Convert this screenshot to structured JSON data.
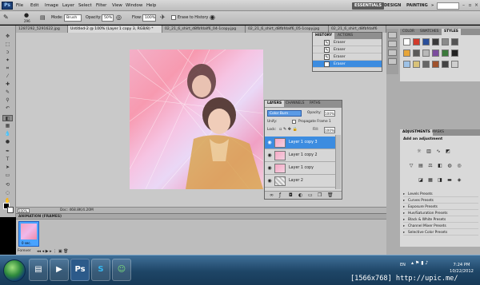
{
  "app": {
    "logo": "Ps"
  },
  "menu": [
    "File",
    "Edit",
    "Image",
    "Layer",
    "Select",
    "Filter",
    "View",
    "Window",
    "Help"
  ],
  "workspaces": {
    "essentials": "ESSENTIALS",
    "design": "DESIGN",
    "painting": "PAINTING",
    "more": "»"
  },
  "options": {
    "brush_size": "296",
    "mode_label": "Mode:",
    "mode_value": "Brush",
    "opacity_label": "Opacity:",
    "opacity_value": "50%",
    "flow_label": "Flow:",
    "flow_value": "100%",
    "erase_history": "Erase to History"
  },
  "tabs": [
    {
      "label": "1287292_5291622.jpg"
    },
    {
      "label": "Untitled-2 @ 100% (Layer 1 copy 3, RGB/8) *"
    },
    {
      "label": "02_21_6_shirt_d8fbfdalf6_04-1copy.jpg"
    },
    {
      "label": "02_21_6_shirt_d8fbfdalf6_05-1copy.jpg"
    },
    {
      "label": "02_21_6_shirt_d8fbfdalf6"
    }
  ],
  "status": {
    "zoom": "100%",
    "doc": "Doc: 468.8K/4.20M"
  },
  "history": {
    "tabs": [
      "HISTORY",
      "ACTIONS"
    ],
    "items": [
      {
        "label": "Eraser"
      },
      {
        "label": "Eraser"
      },
      {
        "label": "Eraser"
      },
      {
        "label": "Eraser"
      }
    ]
  },
  "layers": {
    "tabs": [
      "LAYERS",
      "CHANNELS",
      "PATHS"
    ],
    "blend_mode": "Color Burn",
    "opacity_label": "Opacity:",
    "opacity": "100%",
    "unify_label": "Unify:",
    "propagate_label": "Propagate Frame 1",
    "lock_label": "Lock:",
    "fill_label": "Fill:",
    "fill": "100%",
    "items": [
      {
        "name": "Layer 1 copy 3"
      },
      {
        "name": "Layer 1 copy 2"
      },
      {
        "name": "Layer 1 copy"
      },
      {
        "name": "Layer 2"
      }
    ]
  },
  "right_panels": {
    "color_tabs": [
      "COLOR",
      "SWATCHES",
      "STYLES"
    ],
    "adj_tabs": [
      "ADJUSTMENTS",
      "MASKS"
    ],
    "adj_title": "Add an adjustment",
    "presets": [
      "Levels Presets",
      "Curves Presets",
      "Exposure Presets",
      "Hue/Saturation Presets",
      "Black & White Presets",
      "Channel Mixer Presets",
      "Selective Color Presets"
    ]
  },
  "animation": {
    "title": "ANIMATION (FRAMES)",
    "frame_time": "0 sec.",
    "loop": "Forever"
  },
  "taskbar": {
    "lang": "EN",
    "time": "7:24 PM",
    "date": "10/22/2012"
  },
  "watermark": "[1566x768] http://upic.me/",
  "colors": {
    "selection": "#3c8ce0",
    "taskbar": "#1e4566"
  }
}
